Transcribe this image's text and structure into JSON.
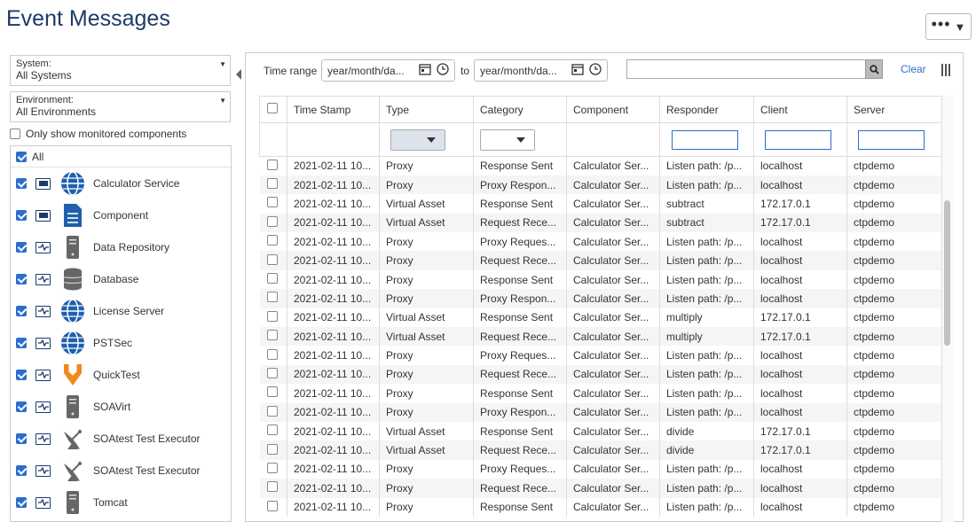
{
  "page": {
    "title": "Event Messages"
  },
  "toolbar": {
    "more_label": "•••"
  },
  "filters": {
    "system_label": "System:",
    "system_value": "All Systems",
    "environment_label": "Environment:",
    "environment_value": "All Environments",
    "monitored_label": "Only show monitored components",
    "all_label": "All"
  },
  "components": [
    {
      "name": "Calculator Service",
      "icon": "globe-icon"
    },
    {
      "name": "Component",
      "icon": "document-icon"
    },
    {
      "name": "Data Repository",
      "icon": "server-icon"
    },
    {
      "name": "Database",
      "icon": "database-icon"
    },
    {
      "name": "License Server",
      "icon": "globe-icon"
    },
    {
      "name": "PSTSec",
      "icon": "globe-icon"
    },
    {
      "name": "QuickTest",
      "icon": "quicktest-icon"
    },
    {
      "name": "SOAVirt",
      "icon": "server-icon"
    },
    {
      "name": "SOAtest Test Executor",
      "icon": "satellite-dish-icon"
    },
    {
      "name": "SOAtest Test Executor",
      "icon": "satellite-dish-icon"
    },
    {
      "name": "Tomcat",
      "icon": "server-icon"
    }
  ],
  "time_range": {
    "label": "Time range",
    "from_value": "year/month/da...",
    "to_label": "to",
    "to_value": "year/month/da...",
    "clear_label": "Clear"
  },
  "table": {
    "columns": [
      "Time Stamp",
      "Type",
      "Category",
      "Component",
      "Responder",
      "Client",
      "Server"
    ],
    "rows": [
      [
        "2021-02-11 10...",
        "Proxy",
        "Response Sent",
        "Calculator Ser...",
        "Listen path: /p...",
        "localhost",
        "ctpdemo"
      ],
      [
        "2021-02-11 10...",
        "Proxy",
        "Proxy Respon...",
        "Calculator Ser...",
        "Listen path: /p...",
        "localhost",
        "ctpdemo"
      ],
      [
        "2021-02-11 10...",
        "Virtual Asset",
        "Response Sent",
        "Calculator Ser...",
        "subtract",
        "172.17.0.1",
        "ctpdemo"
      ],
      [
        "2021-02-11 10...",
        "Virtual Asset",
        "Request Rece...",
        "Calculator Ser...",
        "subtract",
        "172.17.0.1",
        "ctpdemo"
      ],
      [
        "2021-02-11 10...",
        "Proxy",
        "Proxy Reques...",
        "Calculator Ser...",
        "Listen path: /p...",
        "localhost",
        "ctpdemo"
      ],
      [
        "2021-02-11 10...",
        "Proxy",
        "Request Rece...",
        "Calculator Ser...",
        "Listen path: /p...",
        "localhost",
        "ctpdemo"
      ],
      [
        "2021-02-11 10...",
        "Proxy",
        "Response Sent",
        "Calculator Ser...",
        "Listen path: /p...",
        "localhost",
        "ctpdemo"
      ],
      [
        "2021-02-11 10...",
        "Proxy",
        "Proxy Respon...",
        "Calculator Ser...",
        "Listen path: /p...",
        "localhost",
        "ctpdemo"
      ],
      [
        "2021-02-11 10...",
        "Virtual Asset",
        "Response Sent",
        "Calculator Ser...",
        "multiply",
        "172.17.0.1",
        "ctpdemo"
      ],
      [
        "2021-02-11 10...",
        "Virtual Asset",
        "Request Rece...",
        "Calculator Ser...",
        "multiply",
        "172.17.0.1",
        "ctpdemo"
      ],
      [
        "2021-02-11 10...",
        "Proxy",
        "Proxy Reques...",
        "Calculator Ser...",
        "Listen path: /p...",
        "localhost",
        "ctpdemo"
      ],
      [
        "2021-02-11 10...",
        "Proxy",
        "Request Rece...",
        "Calculator Ser...",
        "Listen path: /p...",
        "localhost",
        "ctpdemo"
      ],
      [
        "2021-02-11 10...",
        "Proxy",
        "Response Sent",
        "Calculator Ser...",
        "Listen path: /p...",
        "localhost",
        "ctpdemo"
      ],
      [
        "2021-02-11 10...",
        "Proxy",
        "Proxy Respon...",
        "Calculator Ser...",
        "Listen path: /p...",
        "localhost",
        "ctpdemo"
      ],
      [
        "2021-02-11 10...",
        "Virtual Asset",
        "Response Sent",
        "Calculator Ser...",
        "divide",
        "172.17.0.1",
        "ctpdemo"
      ],
      [
        "2021-02-11 10...",
        "Virtual Asset",
        "Request Rece...",
        "Calculator Ser...",
        "divide",
        "172.17.0.1",
        "ctpdemo"
      ],
      [
        "2021-02-11 10...",
        "Proxy",
        "Proxy Reques...",
        "Calculator Ser...",
        "Listen path: /p...",
        "localhost",
        "ctpdemo"
      ],
      [
        "2021-02-11 10...",
        "Proxy",
        "Request Rece...",
        "Calculator Ser...",
        "Listen path: /p...",
        "localhost",
        "ctpdemo"
      ],
      [
        "2021-02-11 10...",
        "Proxy",
        "Response Sent",
        "Calculator Ser...",
        "Listen path: /p...",
        "localhost",
        "ctpdemo"
      ]
    ]
  },
  "colors": {
    "accent": "#2a6fc9",
    "title": "#1d3a6b"
  }
}
